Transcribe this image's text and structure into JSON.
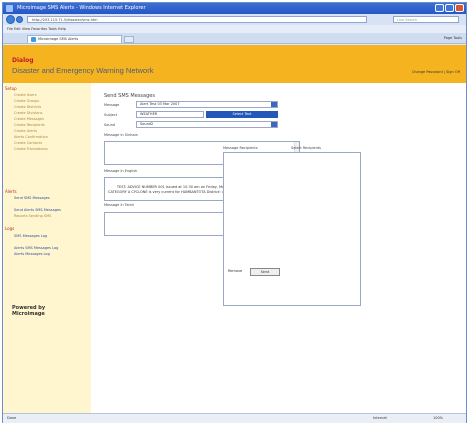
{
  "window": {
    "title": "Microimage SMS Alerts - Windows Internet Explorer"
  },
  "addressbar": {
    "url": "http://203.115.71.5/disaster/sms.htm",
    "search_placeholder": "Live Search"
  },
  "menubar": {
    "text": "File  Edit  View  Favorites  Tools  Help"
  },
  "tab": {
    "label": "Microimage SMS Alerts"
  },
  "commandbar": {
    "text": "Page  Tools"
  },
  "banner": {
    "brand": "Dialog",
    "network": "Disaster and Emergency Warning Network",
    "links": "Change Password  |  Sign Off"
  },
  "sidebar": {
    "sections": [
      {
        "title": "Setup",
        "items": [
          "Create Users",
          "Create Groups",
          "Create Districts",
          "Create Divisions",
          "Create Messages",
          "Create Recipients",
          "Create Alerts",
          "Alerts Confirmation",
          "Create Contacts",
          "Create Translations"
        ]
      },
      {
        "title": "Alerts",
        "items": [
          "Send SMS Messages",
          "Send Alerts SMS Messages",
          "Reports Sending SMS"
        ]
      },
      {
        "title": "Logs",
        "items": [
          "SMS Messages Log",
          "Alerts SMS Messages Log",
          "Alerts Messages Log"
        ]
      }
    ],
    "powered_by": "Powered by",
    "powered_company": "Microimage"
  },
  "form": {
    "title": "Send SMS Messages",
    "message_label": "Message",
    "message_value": "Alert Test 03 Mar 2007",
    "subject_label": "Subject",
    "subject_value": "WEATHER",
    "search_button": "Select Text",
    "sound_label": "Sound",
    "sound_value": "Sound2",
    "sinhala_label": "Message in Sinhala",
    "english_label": "Message in English",
    "english_text": "TEST: ADVICE NUMBER 001 Issued at 10.30 am on Friday, Mar27, 2008 BY UNNiliasa in SEVERE CATEGORY A CYCLONE is very current for HAMBANTOTA District: use",
    "tamil_label": "Message in Tamil"
  },
  "recipients": {
    "title": "Message Recipients",
    "select_label": "Select Recipients",
    "remove_label": "Remove",
    "send_label": "Send"
  },
  "statusbar": {
    "status": "Done",
    "zone": "Internet",
    "zoom": "100%"
  }
}
